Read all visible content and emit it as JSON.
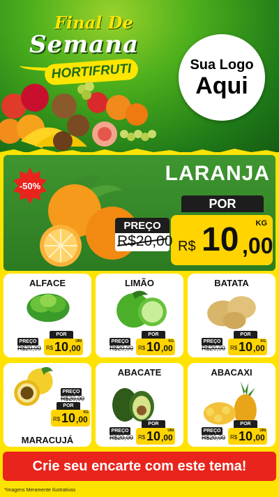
{
  "header": {
    "title_line1": "Final De",
    "title_line2": "Semana",
    "badge": "HORTIFRUTI",
    "logo_line1": "Sua Logo",
    "logo_line2": "Aqui"
  },
  "feature": {
    "discount": "-50%",
    "name": "LARANJA",
    "preco_label": "PREÇO",
    "old_price": "R$20,00",
    "por_label": "POR",
    "currency": "R$",
    "price_int": "10",
    "price_cents": ",00",
    "unit": "KG"
  },
  "cards": [
    {
      "name": "ALFACE",
      "preco_label": "PREÇO",
      "old_price": "R$20,00",
      "por_label": "POR",
      "currency": "R$",
      "price_int": "10",
      "price_cents": ",00",
      "unit": "UNI"
    },
    {
      "name": "LIMÃO",
      "preco_label": "PREÇO",
      "old_price": "R$20,00",
      "por_label": "POR",
      "currency": "R$",
      "price_int": "10",
      "price_cents": ",00",
      "unit": "KG"
    },
    {
      "name": "BATATA",
      "preco_label": "PREÇO",
      "old_price": "R$20,00",
      "por_label": "POR",
      "currency": "R$",
      "price_int": "10",
      "price_cents": ",00",
      "unit": "KG"
    },
    {
      "name": "MARACUJÁ",
      "preco_label": "PREÇO",
      "old_price": "R$20,00",
      "por_label": "POR",
      "currency": "R$",
      "price_int": "10",
      "price_cents": ",00",
      "unit": "KG"
    },
    {
      "name": "ABACATE",
      "preco_label": "PREÇO",
      "old_price": "R$20,00",
      "por_label": "POR",
      "currency": "R$",
      "price_int": "10",
      "price_cents": ",00",
      "unit": "UNI"
    },
    {
      "name": "ABACAXI",
      "preco_label": "PREÇO",
      "old_price": "R$20,00",
      "por_label": "POR",
      "currency": "R$",
      "price_int": "10",
      "price_cents": ",00",
      "unit": "UNI"
    }
  ],
  "cta": "Crie seu encarte com este tema!",
  "footnote": "*Imagens Meramente Ilustrativas",
  "colors": {
    "green": "#2c7b21",
    "yellow": "#ffe300",
    "price_yellow": "#ffd400",
    "red": "#e8241c",
    "dark": "#1d1d1d"
  },
  "icons": [
    "fruit-pile-icon",
    "orange-icon",
    "lettuce-icon",
    "lime-icon",
    "potato-icon",
    "passion-fruit-icon",
    "avocado-icon",
    "pineapple-icon"
  ]
}
